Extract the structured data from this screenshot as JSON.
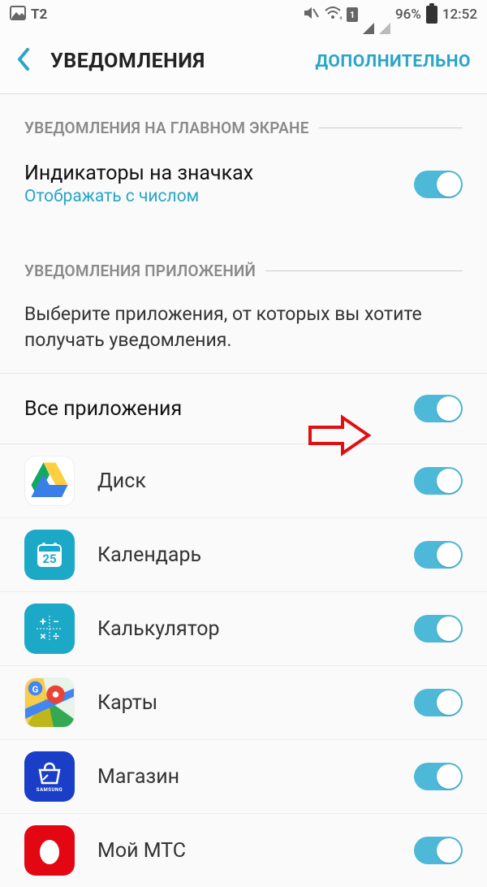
{
  "status": {
    "left_text": "T2",
    "battery_pct": "96%",
    "time": "12:52"
  },
  "header": {
    "title": "УВЕДОМЛЕНИЯ",
    "action": "ДОПОЛНИТЕЛЬНО"
  },
  "section1": {
    "header": "УВЕДОМЛЕНИЯ НА ГЛАВНОМ ЭКРАНЕ",
    "item": {
      "title": "Индикаторы на значках",
      "subtitle": "Отображать с числом"
    }
  },
  "section2": {
    "header": "УВЕДОМЛЕНИЯ ПРИЛОЖЕНИЙ",
    "description": "Выберите приложения, от которых вы хотите получать уведомления.",
    "all_apps": "Все приложения"
  },
  "apps": [
    {
      "name": "Диск"
    },
    {
      "name": "Календарь"
    },
    {
      "name": "Калькулятор"
    },
    {
      "name": "Карты"
    },
    {
      "name": "Магазин"
    },
    {
      "name": "Мой МТС"
    }
  ]
}
